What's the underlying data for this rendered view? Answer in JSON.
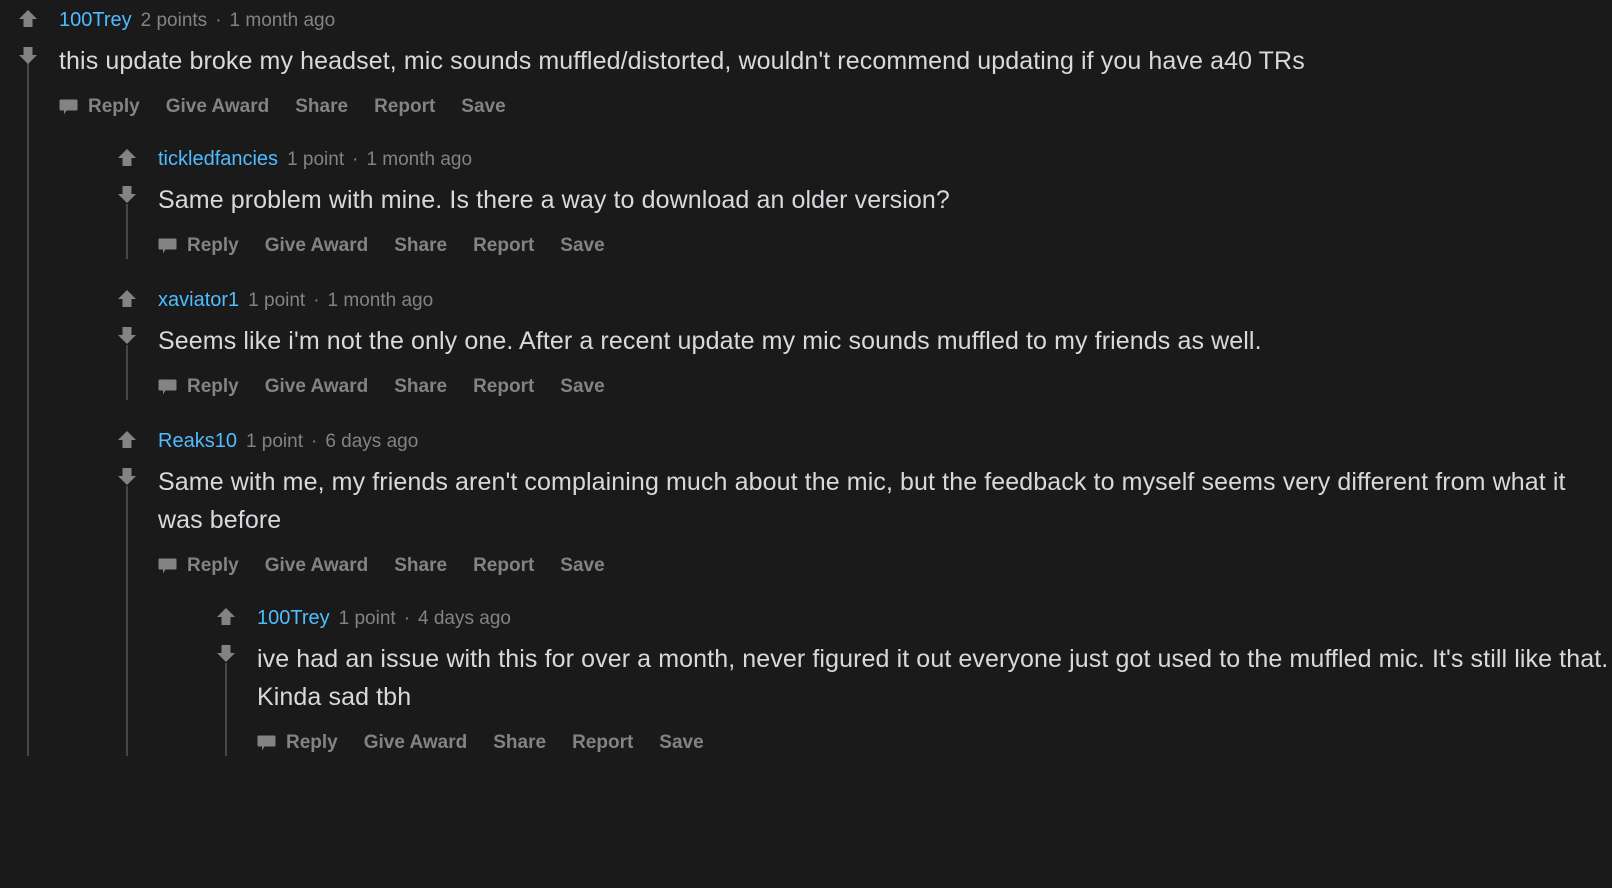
{
  "theme": {
    "background": "#1A1A1B",
    "body_text": "#D7DADC",
    "meta_text": "#818384",
    "username_link": "#4FBCFF",
    "threadline": "#474748",
    "arrow": "#818384"
  },
  "actions": {
    "reply": "Reply",
    "give_award": "Give Award",
    "share": "Share",
    "report": "Report",
    "save": "Save",
    "reply_icon": "speech-bubble-icon",
    "upvote_icon": "upvote-arrow-icon",
    "downvote_icon": "downvote-arrow-icon"
  },
  "separator": "·",
  "comments": [
    {
      "id": "c0",
      "depth": 0,
      "author": "100Trey",
      "points": "2 points",
      "age": "1 month ago",
      "body": "this update broke my headset, mic sounds muffled/distorted, wouldn't recommend updating if you have a40 TRs"
    },
    {
      "id": "c1",
      "depth": 1,
      "author": "tickledfancies",
      "points": "1 point",
      "age": "1 month ago",
      "body": "Same problem with mine. Is there a way to download an older version?"
    },
    {
      "id": "c2",
      "depth": 1,
      "author": "xaviator1",
      "points": "1 point",
      "age": "1 month ago",
      "body": "Seems like i'm not the only one. After a recent update my mic sounds muffled to my friends as well."
    },
    {
      "id": "c3",
      "depth": 1,
      "author": "Reaks10",
      "points": "1 point",
      "age": "6 days ago",
      "body": "Same with me, my friends aren't complaining much about the mic, but the feedback to myself seems very different from what it was before"
    },
    {
      "id": "c4",
      "depth": 2,
      "author": "100Trey",
      "points": "1 point",
      "age": "4 days ago",
      "body": "ive had an issue with this for over a month, never figured it out everyone just got used to the muffled mic. It's still like that. Kinda sad tbh"
    }
  ]
}
